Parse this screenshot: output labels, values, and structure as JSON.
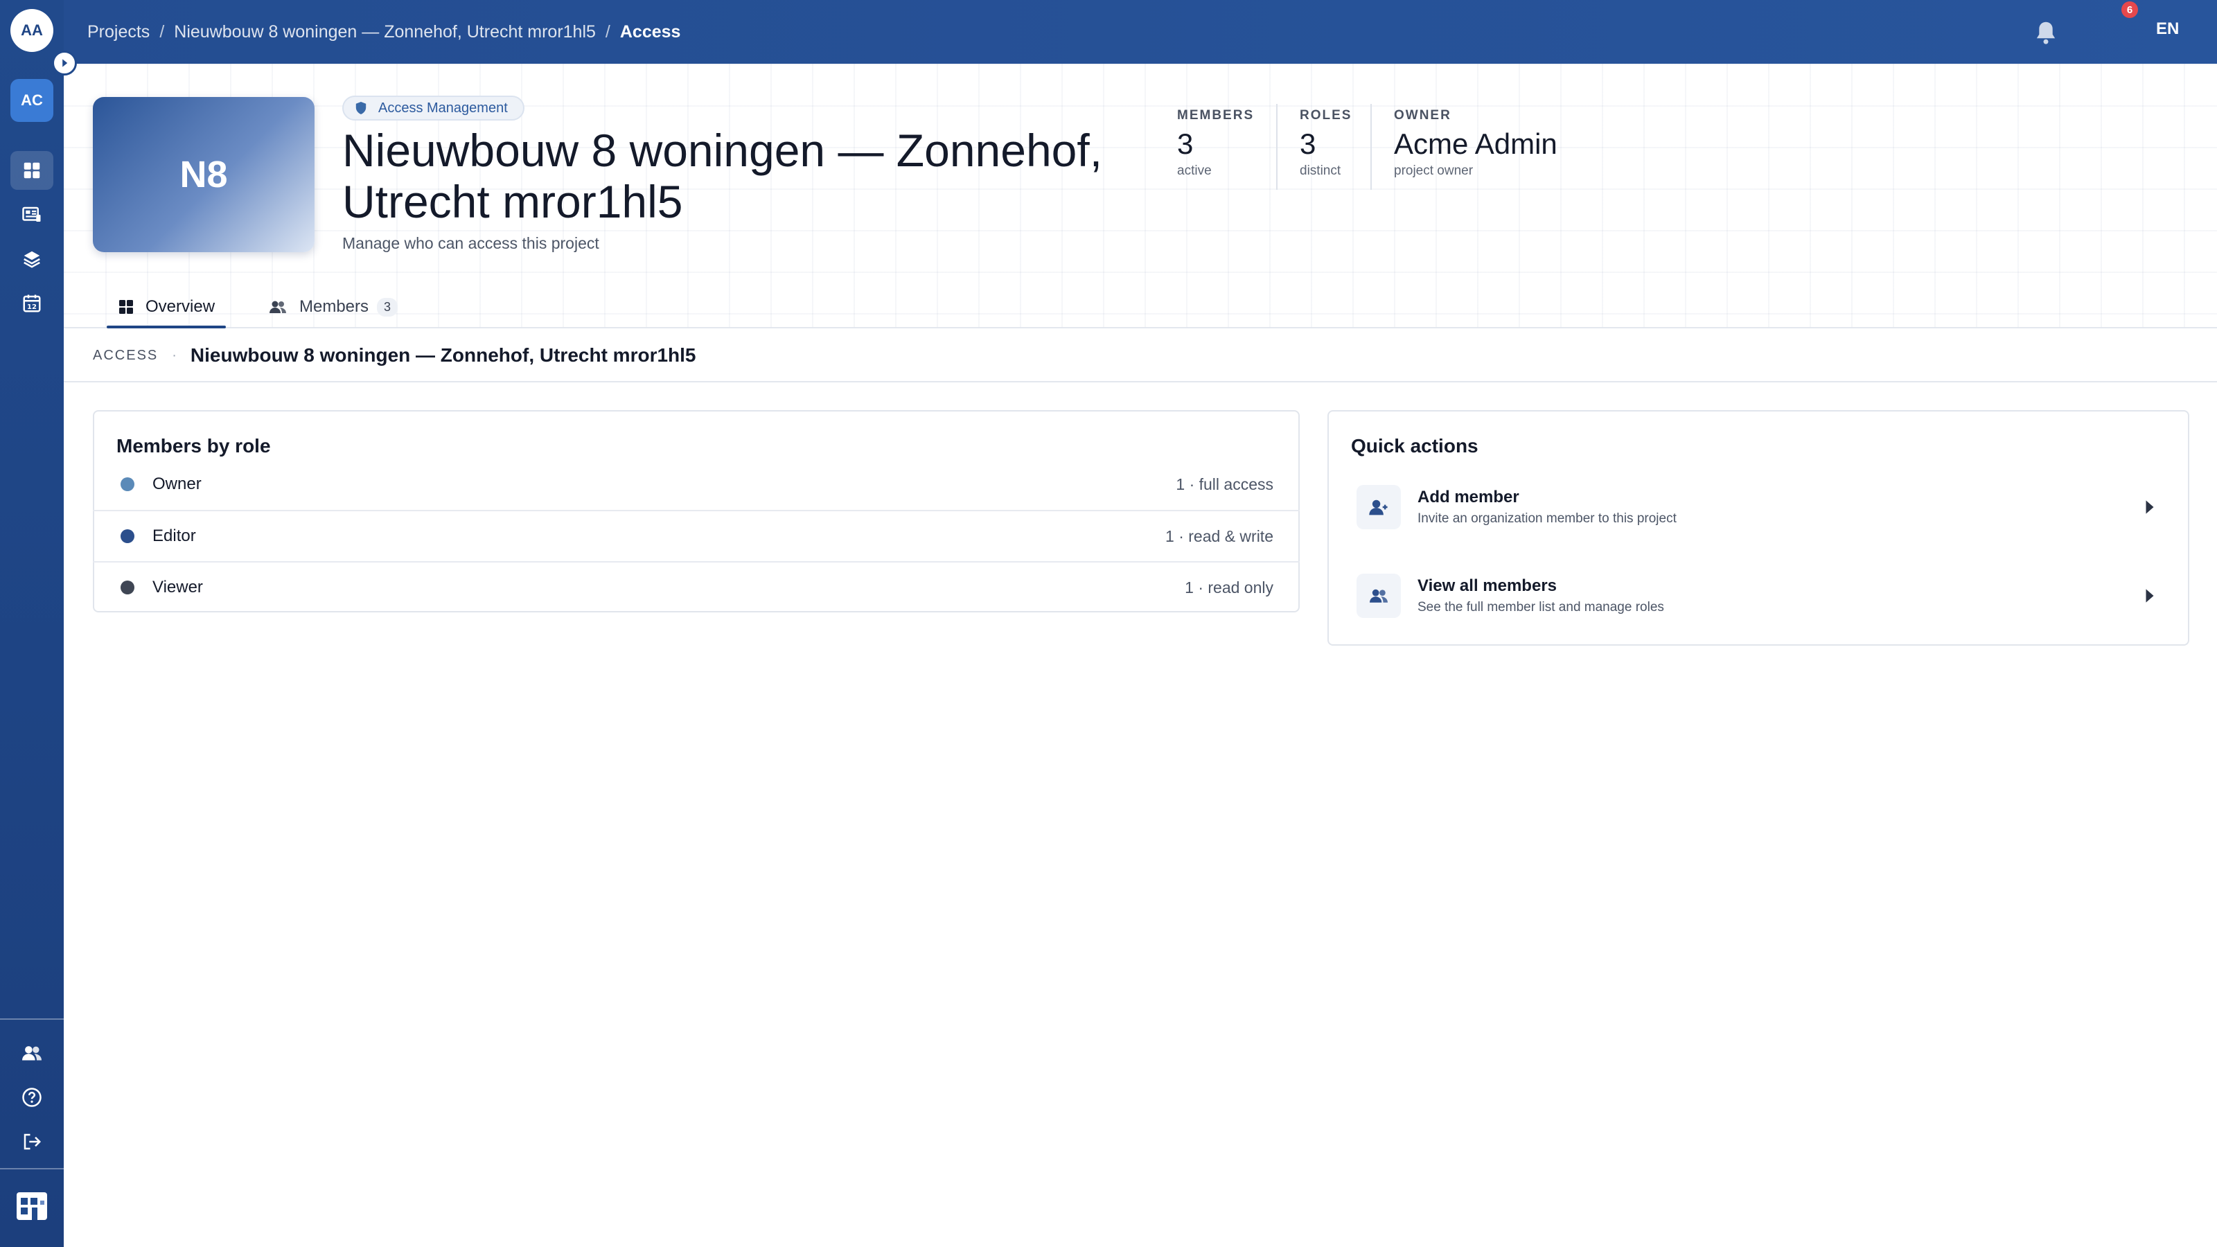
{
  "sidebar": {
    "user_initials": "AA",
    "org_initials": "AC",
    "items": [
      {
        "name": "dashboard",
        "icon": "grid-icon",
        "active": true
      },
      {
        "name": "documents",
        "icon": "news-icon",
        "active": false
      },
      {
        "name": "layers",
        "icon": "layers-icon",
        "active": false
      },
      {
        "name": "calendar",
        "icon": "calendar-icon",
        "calendar_day": "12",
        "active": false
      }
    ],
    "bottom_items": [
      {
        "name": "members",
        "icon": "users-icon"
      },
      {
        "name": "help",
        "icon": "help-icon"
      },
      {
        "name": "logout",
        "icon": "logout-icon"
      }
    ]
  },
  "topbar": {
    "breadcrumb": {
      "projects": "Projects",
      "project": "Nieuwbouw 8 woningen — Zonnehof, Utrecht mror1hl5",
      "current": "Access",
      "separator": "/"
    },
    "notification_count": "6",
    "language": "EN"
  },
  "header": {
    "tile_initials": "N8",
    "chip_label": "Access Management",
    "title": "Nieuwbouw 8 woningen — Zonnehof, Utrecht mror1hl5",
    "subtitle": "Manage who can access this project",
    "stats": {
      "members": {
        "label": "MEMBERS",
        "value": "3",
        "sub": "active"
      },
      "roles": {
        "label": "ROLES",
        "value": "3",
        "sub": "distinct"
      },
      "owner": {
        "label": "OWNER",
        "value": "Acme Admin",
        "sub": "project owner"
      }
    }
  },
  "tabs": [
    {
      "label": "Overview",
      "icon": "grid-icon",
      "active": true
    },
    {
      "label": "Members",
      "icon": "users-icon",
      "count": "3",
      "active": false
    }
  ],
  "access_bar": {
    "label": "ACCESS",
    "separator": "·",
    "name": "Nieuwbouw 8 woningen — Zonnehof, Utrecht mror1hl5"
  },
  "members_by_role": {
    "title": "Members by role",
    "roles": [
      {
        "name": "Owner",
        "detail": "1 · full access",
        "color": "#5b8ab8"
      },
      {
        "name": "Editor",
        "detail": "1 · read & write",
        "color": "#2c4f8c"
      },
      {
        "name": "Viewer",
        "detail": "1 · read only",
        "color": "#3f4654"
      }
    ]
  },
  "quick_actions": {
    "title": "Quick actions",
    "items": [
      {
        "title": "Add member",
        "description": "Invite an organization member to this project",
        "icon": "add-user-icon"
      },
      {
        "title": "View all members",
        "description": "See the full member list and manage roles",
        "icon": "users-icon"
      }
    ]
  },
  "colors": {
    "brand": "#214a8c",
    "accent": "#3a7bd5",
    "badge": "#e5484d"
  }
}
